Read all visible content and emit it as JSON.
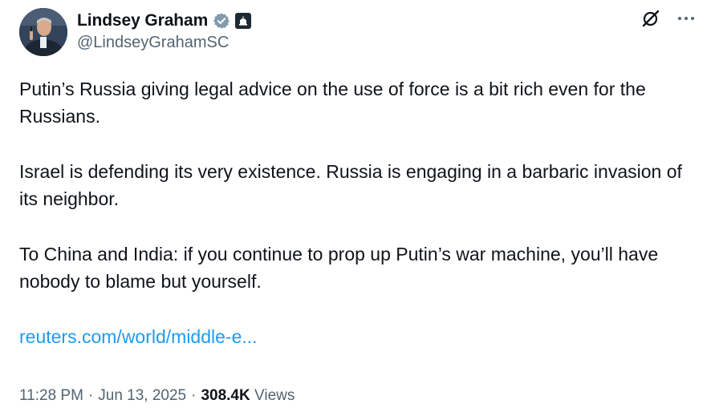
{
  "author": {
    "name": "Lindsey Graham",
    "handle": "@LindseyGrahamSC",
    "verified_icon": "verified-badge-icon",
    "affiliation_icon": "government-building-icon",
    "avatar_icon": "profile-photo"
  },
  "actions": {
    "grok_icon": "grok-icon",
    "more_icon": "more-options-icon"
  },
  "tweet": {
    "paragraphs": [
      "Putin’s Russia giving legal advice on the use of force is a bit rich even for the Russians.",
      "Israel is defending its very existence. Russia is engaging in a barbaric invasion of its neighbor.",
      "To China and India: if you continue to prop up Putin’s war machine, you’ll have nobody to blame but yourself."
    ],
    "link_text": "reuters.com/world/middle-e..."
  },
  "meta": {
    "time": "11:28 PM",
    "separator": "·",
    "date": "Jun 13, 2025",
    "views_count": "308.4K",
    "views_label": "Views"
  },
  "colors": {
    "text": "#0f1419",
    "secondary": "#536471",
    "link": "#1d9bf0",
    "verified": "#829aab"
  }
}
